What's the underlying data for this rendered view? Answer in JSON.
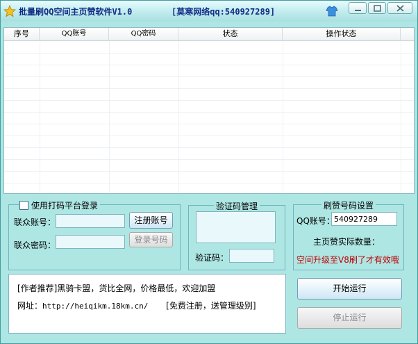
{
  "window": {
    "title": "批量刷QQ空间主页赞软件V1.0",
    "contact": "[莫寒网络qq:540927289]"
  },
  "table": {
    "columns": [
      "序号",
      "QQ账号",
      "QQ密码",
      "状态",
      "操作状态"
    ],
    "rows": []
  },
  "login_group": {
    "checkbox_label": "使用打码平台登录",
    "checked": false,
    "account_label": "联众账号：",
    "password_label": "联众密码：",
    "account_value": "",
    "password_value": "",
    "register_button": "注册账号",
    "login_button": "登录号码"
  },
  "captcha_group": {
    "title": "验证码管理",
    "code_label": "验证码：",
    "code_value": ""
  },
  "settings_group": {
    "title": "刷赞号码设置",
    "qq_label": "QQ账号：",
    "qq_value": "540927289",
    "actual_count_label": "主页赞实际数量：",
    "upgrade_note": "空间升级至V8刷了才有效哦"
  },
  "notice": {
    "line1": "[作者推荐]黑骑卡盟，货比全网，价格最低，欢迎加盟",
    "url_label": "网址：",
    "url": "http://heiqikm.18km.cn/",
    "url_suffix": "[免费注册，送管理级别]"
  },
  "actions": {
    "start_button": "开始运行",
    "stop_button": "停止运行"
  },
  "colors": {
    "background": "#aee6e3",
    "title_text": "#0f2d86",
    "warning_text": "#c00000"
  }
}
